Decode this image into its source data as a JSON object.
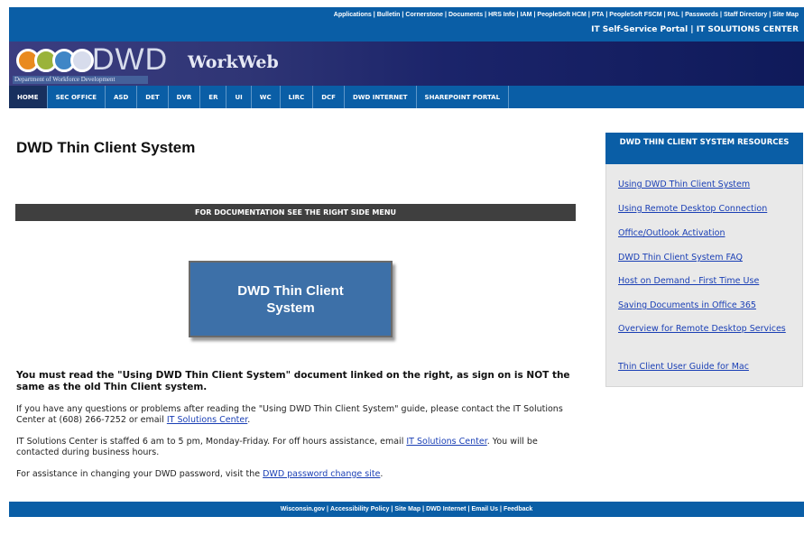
{
  "util_links": [
    "Applications",
    "Bulletin",
    "Cornerstone",
    "Documents",
    "HRS Info",
    "IAM",
    "PeopleSoft HCM",
    "PTA",
    "PeopleSoft FSCM",
    "PAL",
    "Passwords",
    "Staff Directory",
    "Site Map"
  ],
  "portal": {
    "self_service": "IT Self-Service Portal",
    "separator": "|",
    "solutions": "IT SOLUTIONS CENTER"
  },
  "banner": {
    "logo_text": "DWD",
    "dept_text": "Department of Workforce Development",
    "app_name": "WorkWeb"
  },
  "nav": [
    "HOME",
    "SEC OFFICE",
    "ASD",
    "DET",
    "DVR",
    "ER",
    "UI",
    "WC",
    "LIRC",
    "DCF",
    "DWD INTERNET",
    "SHAREPOINT PORTAL"
  ],
  "main": {
    "title": "DWD Thin Client System",
    "doc_bar": "FOR DOCUMENTATION SEE THE RIGHT SIDE MENU",
    "button_label": "DWD Thin Client System",
    "notice": "You must read the \"Using DWD Thin Client System\" document linked on the right, as sign on is NOT the same as the old Thin Client system.",
    "p2_text": "If you have any questions or problems after reading the \"Using DWD Thin Client System\" guide, please contact the IT Solutions Center at (608) 266-7252 or email ",
    "p2_link": "IT Solutions Center",
    "p2_end": ".",
    "p3_text": "IT Solutions Center is staffed 6 am to 5 pm, Monday-Friday. For off hours assistance, email ",
    "p3_link": "IT Solutions Center",
    "p3_end": ". You will be contacted during business hours.",
    "p4_text": "For assistance in changing your DWD password, visit the ",
    "p4_link": "DWD password change site",
    "p4_end": "."
  },
  "sidebar": {
    "heading": "DWD THIN CLIENT SYSTEM RESOURCES",
    "links": [
      "Using DWD Thin Client System",
      "Using Remote Desktop Connection",
      "Office/Outlook Activation",
      "DWD Thin Client System FAQ",
      "Host on Demand - First Time Use",
      "Saving Documents in Office 365",
      "Overview for Remote Desktop Services",
      "Thin Client User Guide for Mac"
    ]
  },
  "footer": [
    "Wisconsin.gov",
    "Accessibility Policy",
    "Site Map",
    "DWD Internet",
    "Email Us",
    "Feedback"
  ],
  "colors": {
    "primary_blue": "#0a5ea6",
    "nav_active": "#18305e",
    "button_blue": "#3d70a8",
    "doc_bar": "#3f3f3f",
    "link": "#1a3fb5",
    "sidebar_bg": "#e9e9e9"
  },
  "logo_circle_colors": [
    "#e98a1f",
    "#9ab33a",
    "#3f86c6",
    "#d7dcec"
  ]
}
